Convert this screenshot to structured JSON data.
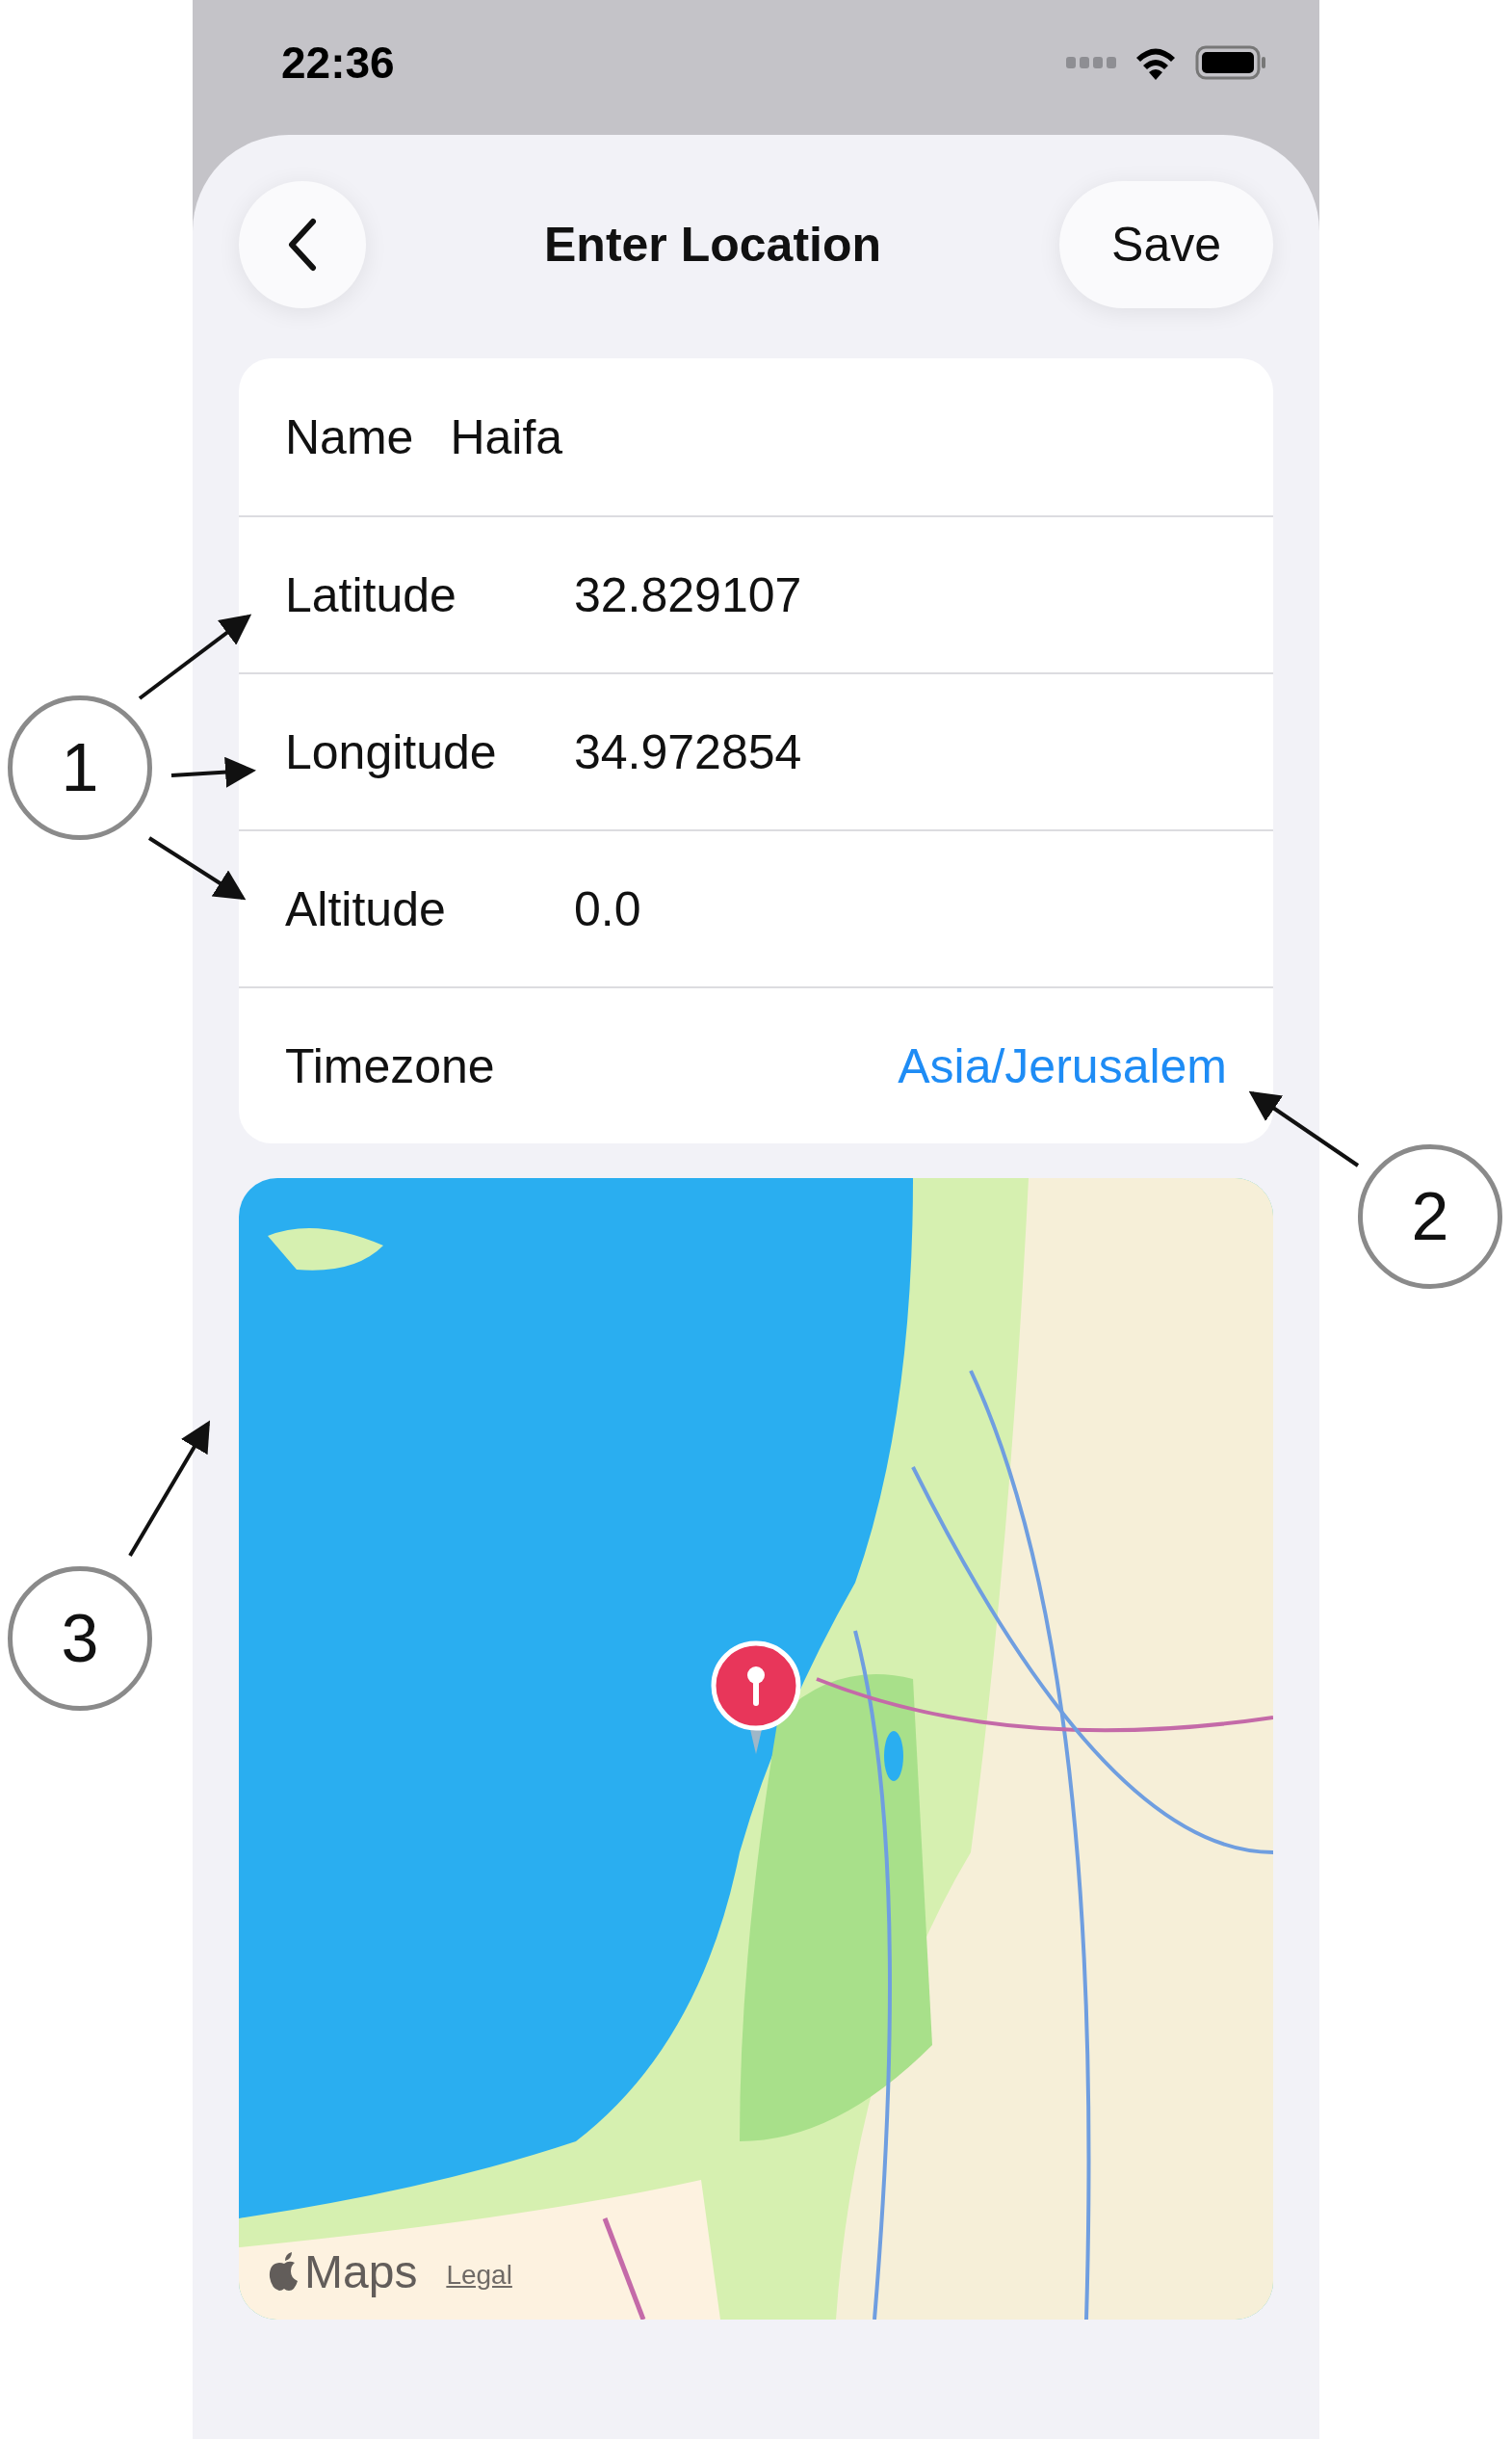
{
  "status_bar": {
    "time": "22:36"
  },
  "nav": {
    "title": "Enter Location",
    "action": "Save"
  },
  "fields": [
    {
      "kind": "inline",
      "label": "Name",
      "value": "Haifa"
    },
    {
      "kind": "column",
      "label": "Latitude",
      "value": "32.829107"
    },
    {
      "kind": "column",
      "label": "Longitude",
      "value": "34.972854"
    },
    {
      "kind": "column",
      "label": "Altitude",
      "value": "0.0"
    },
    {
      "kind": "link",
      "label": "Timezone",
      "value": "Asia/Jerusalem"
    }
  ],
  "map": {
    "kind": "picture",
    "attribution": "Maps",
    "legal": "Legal"
  },
  "callouts": [
    {
      "number": "1"
    },
    {
      "number": "2"
    },
    {
      "number": "3"
    }
  ]
}
